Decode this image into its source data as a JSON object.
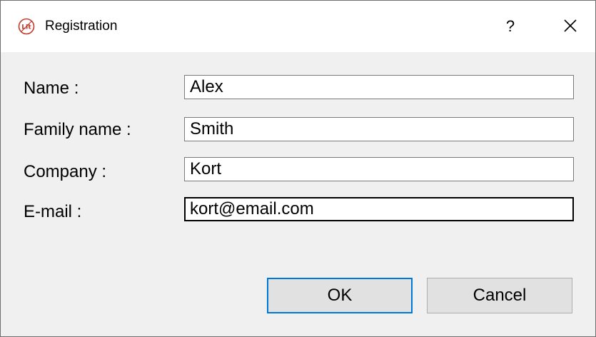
{
  "window": {
    "title": "Registration",
    "help_label": "?",
    "icon": "lit-logo-icon"
  },
  "form": {
    "fields": [
      {
        "label": "Name :",
        "value": "Alex"
      },
      {
        "label": "Family name :",
        "value": "Smith"
      },
      {
        "label": "Company :",
        "value": "Kort"
      },
      {
        "label": "E-mail :",
        "value": "kort@email.com"
      }
    ]
  },
  "buttons": {
    "ok_label": "OK",
    "cancel_label": "Cancel"
  },
  "colors": {
    "dialog_background": "#f0f0f0",
    "titlebar_background": "#ffffff",
    "default_button_border": "#0078d7",
    "button_background": "#e1e1e1"
  }
}
